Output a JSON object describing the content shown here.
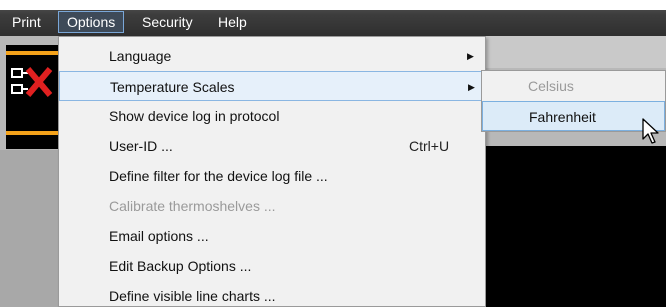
{
  "menubar": {
    "items": [
      {
        "label": "Print"
      },
      {
        "label": "Options"
      },
      {
        "label": "Security"
      },
      {
        "label": "Help"
      }
    ]
  },
  "options_menu": {
    "items": [
      {
        "label": "Language",
        "shortcut": "",
        "has_submenu": true
      },
      {
        "label": "Temperature Scales",
        "shortcut": "",
        "has_submenu": true
      },
      {
        "label": "Show device log in protocol",
        "shortcut": ""
      },
      {
        "label": "User-ID ...",
        "shortcut": "Ctrl+U"
      },
      {
        "label": "Define filter for the device log file ...",
        "shortcut": ""
      },
      {
        "label": "Calibrate thermoshelves ...",
        "shortcut": "",
        "disabled": true
      },
      {
        "label": "Email options ...",
        "shortcut": ""
      },
      {
        "label": "Edit Backup Options ...",
        "shortcut": ""
      },
      {
        "label": "Define visible line charts ...",
        "shortcut": ""
      }
    ]
  },
  "temperature_submenu": {
    "items": [
      {
        "label": "Celsius",
        "disabled": true
      },
      {
        "label": "Fahrenheit",
        "selected": true
      }
    ]
  },
  "colors": {
    "menubar_bg": "#333333",
    "highlight_border": "#8ab6e2",
    "disabled_text": "#9a9a9a",
    "accent_orange": "#f4a21a"
  }
}
